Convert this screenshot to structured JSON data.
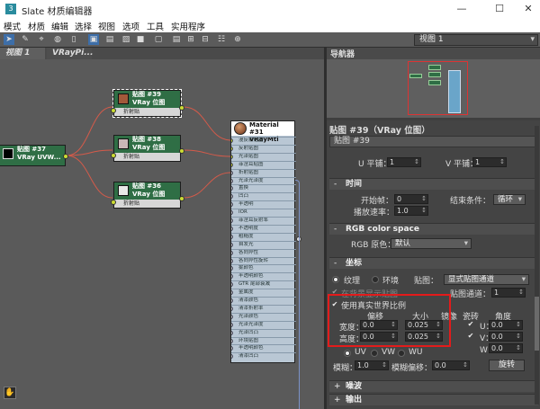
{
  "window": {
    "title": "Slate 材质编辑器",
    "minimize": "—",
    "maximize": "☐",
    "close": "✕"
  },
  "menu": [
    "模式",
    "材质",
    "编辑",
    "选择",
    "视图",
    "选项",
    "工具",
    "实用程序"
  ],
  "toolbar": {
    "view_select": "视图 1"
  },
  "tabs": [
    "视图 1",
    "VRayPi..."
  ],
  "nodes": {
    "map37": {
      "title": "贴图 #37",
      "sub": "VRay UVW..."
    },
    "map39": {
      "title": "贴图 #39",
      "sub": "VRay 位图",
      "row": "折射贴"
    },
    "map38": {
      "title": "贴图 #38",
      "sub": "VRay 位图",
      "row": "折射贴"
    },
    "map36": {
      "title": "贴图 #36",
      "sub": "VRay 位图",
      "row": "折射贴"
    },
    "material": {
      "title": "Material #31",
      "sub": "VRayMtl",
      "slots": [
        "漫反射贴图",
        "反射贴图",
        "光泽贴图",
        "菲涅耳贴图",
        "折射贴图",
        "光泽光泽度",
        "置换",
        "凹凸",
        "半透明",
        "IOR",
        "菲涅耳反射率",
        "不透明度",
        "粗糙度",
        "自发光",
        "各向异性",
        "各向异性旋转",
        "雾颜色",
        "半透明颜色",
        "GTR 尾部衰减",
        "金属度",
        "清漆颜色",
        "清漆折射率",
        "光泽颜色",
        "光泽光泽度",
        "光泽凹凸",
        "环境贴图",
        "半透明颜色",
        "清漆凹凸"
      ]
    }
  },
  "navigator": {
    "title": "导航器"
  },
  "panel": {
    "title": "贴图 #39（VRay 位图）",
    "map_name": "贴图 #39",
    "tiling": {
      "u_label": "U 平铺：",
      "u_val": "1",
      "v_label": "V 平铺：",
      "v_val": "1"
    },
    "time": {
      "header": "时间",
      "start_label": "开始帧：",
      "start_val": "0",
      "end_label": "结束条件：",
      "end_val": "循环",
      "rate_label": "播放速率：",
      "rate_val": "1.0"
    },
    "rgb": {
      "header": "RGB color space",
      "label": "RGB 原色：",
      "val": "默认"
    },
    "coords": {
      "header": "坐标",
      "texture": "纹理",
      "environ": "环境",
      "map_label": "贴图：",
      "map_val": "显式贴图通道",
      "show_bg": "在背景显示贴图",
      "channel_label": "贴图通道：",
      "channel_val": "1",
      "real_world": "使用真实世界比例",
      "offset": "偏移",
      "size": "大小",
      "mirror": "镜像",
      "tile": "瓷砖",
      "angle": "角度",
      "width": "宽度：",
      "height": "高度：",
      "w_offset": "0.0",
      "w_size": "0.025",
      "h_offset": "0.0",
      "h_size": "0.025",
      "u": "U：",
      "v": "V：",
      "w": "W：",
      "u_ang": "0.0",
      "v_ang": "0.0",
      "w_ang": "0.0",
      "uv": "UV",
      "vw": "VW",
      "wu": "WU",
      "blur_label": "模糊：",
      "blur_val": "1.0",
      "blur_off_label": "模糊偏移：",
      "blur_off_val": "0.0",
      "rotate": "旋转"
    },
    "noise": {
      "header": "噪波"
    },
    "output": {
      "header": "输出"
    }
  },
  "colors": {
    "node_header": "#2f6e45",
    "highlight": "#e31b1b",
    "connector": "#ccdc33"
  }
}
